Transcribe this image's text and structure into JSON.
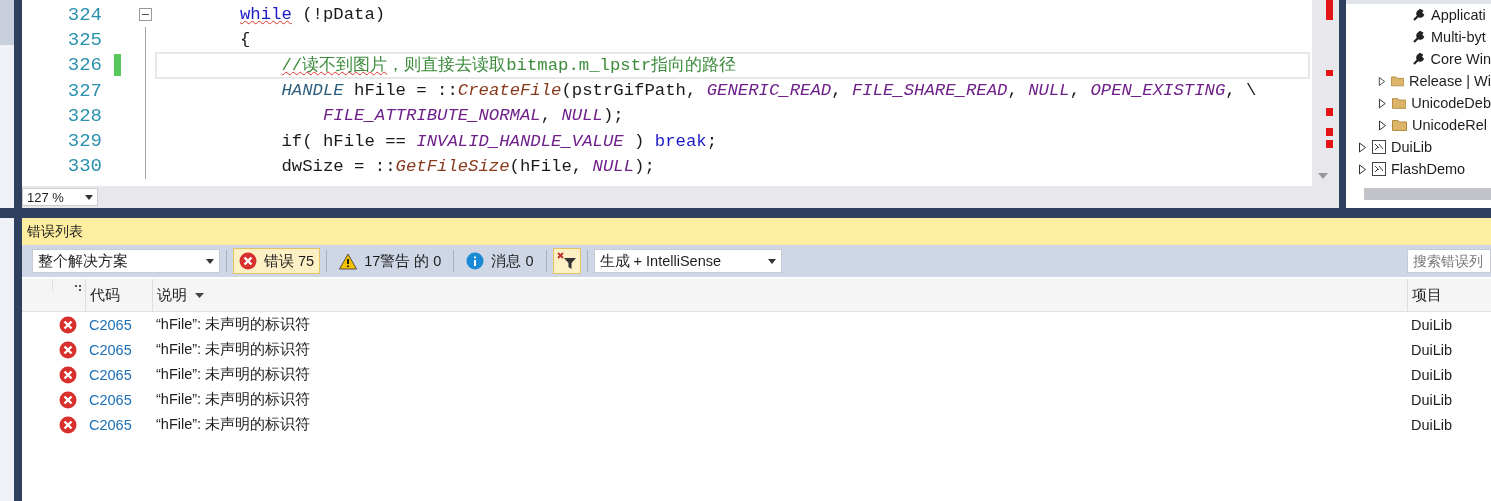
{
  "editor": {
    "lines": [
      {
        "number": "324",
        "current": false,
        "changed": false,
        "foldable": true,
        "tokens": [
          {
            "kind": "keyword",
            "text": "        while",
            "squiggle": true
          },
          {
            "kind": "plain",
            "text": " (!pData)"
          }
        ]
      },
      {
        "number": "325",
        "current": false,
        "changed": false,
        "foldable": false,
        "tokens": [
          {
            "kind": "plain",
            "text": "        {"
          }
        ]
      },
      {
        "number": "326",
        "current": true,
        "changed": true,
        "foldable": false,
        "tokens": [
          {
            "kind": "comment",
            "text": "            //读不到图片",
            "squiggle": true
          },
          {
            "kind": "comment",
            "text": "，则直接去读取bitmap.m_lpstr指向的路径"
          }
        ]
      },
      {
        "number": "327",
        "current": false,
        "changed": false,
        "foldable": false,
        "tokens": [
          {
            "kind": "type",
            "text": "            HANDLE"
          },
          {
            "kind": "plain",
            "text": " hFile = ::"
          },
          {
            "kind": "func",
            "text": "CreateFile"
          },
          {
            "kind": "plain",
            "text": "(pstrGifPath, "
          },
          {
            "kind": "macro",
            "text": "GENERIC_READ"
          },
          {
            "kind": "plain",
            "text": ", "
          },
          {
            "kind": "macro",
            "text": "FILE_SHARE_READ"
          },
          {
            "kind": "plain",
            "text": ", "
          },
          {
            "kind": "macro",
            "text": "NULL"
          },
          {
            "kind": "plain",
            "text": ", "
          },
          {
            "kind": "macro",
            "text": "OPEN_EXISTING"
          },
          {
            "kind": "plain",
            "text": ", \\"
          }
        ]
      },
      {
        "number": "328",
        "current": false,
        "changed": false,
        "foldable": false,
        "tokens": [
          {
            "kind": "macro",
            "text": "                FILE_ATTRIBUTE_NORMAL"
          },
          {
            "kind": "plain",
            "text": ", "
          },
          {
            "kind": "macro",
            "text": "NULL"
          },
          {
            "kind": "plain",
            "text": ");"
          }
        ]
      },
      {
        "number": "329",
        "current": false,
        "changed": false,
        "foldable": false,
        "tokens": [
          {
            "kind": "plain",
            "text": "            if( hFile == "
          },
          {
            "kind": "macro",
            "text": "INVALID_HANDLE_VALUE"
          },
          {
            "kind": "plain",
            "text": " ) "
          },
          {
            "kind": "keyword",
            "text": "break"
          },
          {
            "kind": "plain",
            "text": ";"
          }
        ]
      },
      {
        "number": "330",
        "current": false,
        "changed": false,
        "foldable": false,
        "tokens": [
          {
            "kind": "plain",
            "text": "            dwSize = ::"
          },
          {
            "kind": "func",
            "text": "GetFileSize"
          },
          {
            "kind": "plain",
            "text": "(hFile, "
          },
          {
            "kind": "macro",
            "text": "NULL"
          },
          {
            "kind": "plain",
            "text": ");"
          }
        ]
      }
    ],
    "zoom": "127 %"
  },
  "solution_explorer": {
    "tree": [
      {
        "children": [
          {
            "children": [
              {
                "kind": "setting",
                "label": "Applicati"
              },
              {
                "kind": "setting",
                "label": "Multi-byt"
              },
              {
                "kind": "setting",
                "label": "Core Win"
              }
            ]
          },
          {
            "kind": "folder",
            "label": "Release | Wi",
            "expanded": false
          },
          {
            "kind": "folder",
            "label": "UnicodeDeb",
            "expanded": false
          },
          {
            "kind": "folder",
            "label": "UnicodeRel",
            "expanded": false
          }
        ]
      },
      {
        "kind": "project",
        "label": "DuiLib",
        "expanded": false
      },
      {
        "kind": "project",
        "label": "FlashDemo",
        "expanded": false
      }
    ]
  },
  "error_list": {
    "title": "错误列表",
    "scope": "整个解决方案",
    "filters": [
      {
        "kind": "error",
        "label": "错误 75",
        "selected": true
      },
      {
        "kind": "warning",
        "label": "17警告 的 0",
        "selected": false
      },
      {
        "kind": "info",
        "label": "消息 0",
        "selected": false
      }
    ],
    "filter_toggle": {
      "on": true
    },
    "source": "生成 + IntelliSense",
    "search": {
      "placeholder": "搜索错误列"
    },
    "columns": [
      "代码",
      "说明",
      "项目"
    ],
    "rows": [
      {
        "kind": "error",
        "code": "C2065",
        "description": "“hFile”: 未声明的标识符",
        "project": "DuiLib"
      },
      {
        "kind": "error",
        "code": "C2065",
        "description": "“hFile”: 未声明的标识符",
        "project": "DuiLib"
      },
      {
        "kind": "error",
        "code": "C2065",
        "description": "“hFile”: 未声明的标识符",
        "project": "DuiLib"
      },
      {
        "kind": "error",
        "code": "C2065",
        "description": "“hFile”: 未声明的标识符",
        "project": "DuiLib"
      },
      {
        "kind": "error",
        "code": "C2065",
        "description": "“hFile”: 未声明的标识符",
        "project": "DuiLib"
      }
    ]
  }
}
